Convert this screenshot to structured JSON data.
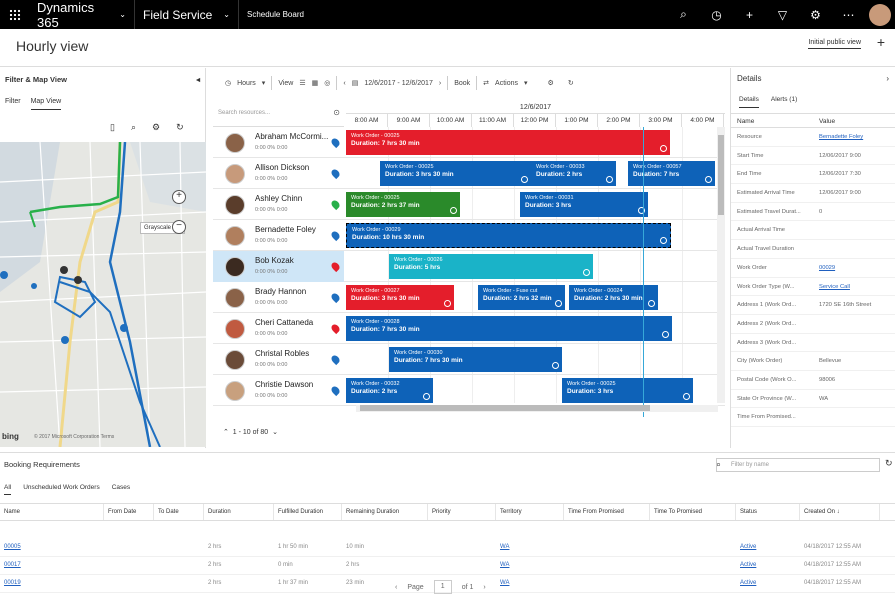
{
  "topbar": {
    "app": "Dynamics 365",
    "area": "Field Service",
    "board": "Schedule Board"
  },
  "title": "Hourly view",
  "view_selector": "Initial public view",
  "left": {
    "header": "Filter & Map View",
    "tabs": [
      "Filter",
      "Map View"
    ],
    "grayscale": "Grayscale",
    "copyright": "© 2017 Microsoft Corporation  Terms",
    "bing": "bing"
  },
  "toolbar": {
    "hours": "Hours",
    "view": "View",
    "range": "12/6/2017 - 12/6/2017",
    "book": "Book",
    "actions": "Actions"
  },
  "board": {
    "search_placeholder": "Search resources...",
    "date": "12/6/2017",
    "hours": [
      "8:00 AM",
      "9:00 AM",
      "10:00 AM",
      "11:00 AM",
      "12:00 PM",
      "1:00 PM",
      "2:00 PM",
      "3:00 PM",
      "4:00 PM"
    ],
    "pager": "1 - 10 of 80"
  },
  "resources": [
    {
      "name": "Abraham McCormi...",
      "meta": "0:00  0%  0:00"
    },
    {
      "name": "Allison Dickson",
      "meta": "0:00  0%  0:00"
    },
    {
      "name": "Ashley Chinn",
      "meta": "0:00  0%  0:00"
    },
    {
      "name": "Bernadette Foley",
      "meta": "0:00  0%  0:00"
    },
    {
      "name": "Bob Kozak",
      "meta": "0:00  0%  0:00"
    },
    {
      "name": "Brady Hannon",
      "meta": "0:00  0%  0:00"
    },
    {
      "name": "Cheri Cattaneda",
      "meta": "0:00  0%  0:00"
    },
    {
      "name": "Christal Robles",
      "meta": "0:00  0%  0:00"
    },
    {
      "name": "Christie Dawson",
      "meta": "0:00  0%  0:00"
    }
  ],
  "bookings": [
    {
      "row": 0,
      "title": "Work Order - 00025",
      "dur": "Duration: 7 hrs 30 min",
      "color": "#e41e2b"
    },
    {
      "row": 1,
      "title": "Work Order - 00025",
      "dur": "Duration: 3 hrs 30 min",
      "color": "#0e62b8"
    },
    {
      "row": 1,
      "title": "Work Order - 00033",
      "dur": "Duration: 2 hrs",
      "color": "#0e62b8"
    },
    {
      "row": 1,
      "title": "Work Order - 00057",
      "dur": "Duration: 7 hrs",
      "color": "#0e62b8"
    },
    {
      "row": 2,
      "title": "Work Order - 00025",
      "dur": "Duration: 2 hrs 37 min",
      "color": "#2a8a2a"
    },
    {
      "row": 2,
      "title": "Work Order - 00031",
      "dur": "Duration: 3 hrs",
      "color": "#0e62b8"
    },
    {
      "row": 3,
      "title": "Work Order - 00029",
      "dur": "Duration: 10 hrs 30 min",
      "color": "#0e62b8"
    },
    {
      "row": 4,
      "title": "Work Order - 00026",
      "dur": "Duration: 5 hrs",
      "color": "#1ab3c8"
    },
    {
      "row": 5,
      "title": "Work Order - 00027",
      "dur": "Duration: 3 hrs 30 min",
      "color": "#e41e2b"
    },
    {
      "row": 5,
      "title": "Work Order - Fuse cut",
      "dur": "Duration: 2 hrs 32 min",
      "color": "#0e62b8"
    },
    {
      "row": 5,
      "title": "Work Order - 00024",
      "dur": "Duration: 2 hrs 30 min",
      "color": "#0e62b8"
    },
    {
      "row": 6,
      "title": "Work Order - 00028",
      "dur": "Duration: 7 hrs 30 min",
      "color": "#0e62b8"
    },
    {
      "row": 7,
      "title": "Work Order - 00030",
      "dur": "Duration: 7 hrs 30 min",
      "color": "#0e62b8"
    },
    {
      "row": 8,
      "title": "Work Order - 00032",
      "dur": "Duration: 2 hrs",
      "color": "#0e62b8"
    },
    {
      "row": 8,
      "title": "Work Order - 00025",
      "dur": "Duration: 3 hrs",
      "color": "#0e62b8"
    }
  ],
  "details": {
    "header": "Details",
    "tabs": [
      "Details",
      "Alerts (1)"
    ],
    "cols": [
      "Name",
      "Value"
    ],
    "rows": [
      {
        "k": "Resource",
        "v": "Bernadette Foley"
      },
      {
        "k": "Start Time",
        "v": "12/06/2017 9:00"
      },
      {
        "k": "End Time",
        "v": "12/06/2017 7:30"
      },
      {
        "k": "Estimated Arrival Time",
        "v": "12/06/2017 9:00"
      },
      {
        "k": "Estimated Travel Durat...",
        "v": "0"
      },
      {
        "k": "Actual Arrival Time",
        "v": ""
      },
      {
        "k": "Actual Travel Duration",
        "v": ""
      },
      {
        "k": "Work Order",
        "v": "00029"
      },
      {
        "k": "Work Order Type (W...",
        "v": "Service Call"
      },
      {
        "k": "Address 1 (Work Ord...",
        "v": "1720 SE 16th Street"
      },
      {
        "k": "Address 2 (Work Ord...",
        "v": ""
      },
      {
        "k": "Address 3 (Work Ord...",
        "v": ""
      },
      {
        "k": "City (Work Order)",
        "v": "Bellevue"
      },
      {
        "k": "Postal Code (Work O...",
        "v": "98006"
      },
      {
        "k": "State Or Province (W...",
        "v": "WA"
      },
      {
        "k": "Time From Promised...",
        "v": ""
      }
    ]
  },
  "bottom": {
    "title": "Booking Requirements",
    "filter": "Filter by name",
    "tabs": [
      "All",
      "Unscheduled Work Orders",
      "Cases"
    ],
    "cols": [
      "Name",
      "From Date",
      "To Date",
      "Duration",
      "Fulfilled Duration",
      "Remaining Duration",
      "Priority",
      "Territory",
      "Time From Promised",
      "Time To Promised",
      "Status",
      "Created On ↓"
    ],
    "rows": [
      {
        "name": "00005",
        "dur": "2 hrs",
        "ful": "1 hr 50 min",
        "rem": "10 min",
        "ter": "WA",
        "status": "Active",
        "created": "04/18/2017 12:55 AM"
      },
      {
        "name": "00017",
        "dur": "2 hrs",
        "ful": "0 min",
        "rem": "2 hrs",
        "ter": "WA",
        "status": "Active",
        "created": "04/18/2017 12:55 AM"
      },
      {
        "name": "00019",
        "dur": "2 hrs",
        "ful": "1 hr 37 min",
        "rem": "23 min",
        "ter": "WA",
        "status": "Active",
        "created": "04/18/2017 12:55 AM"
      }
    ],
    "pager_page": "Page",
    "pager_num": "1",
    "pager_of": "of 1"
  }
}
